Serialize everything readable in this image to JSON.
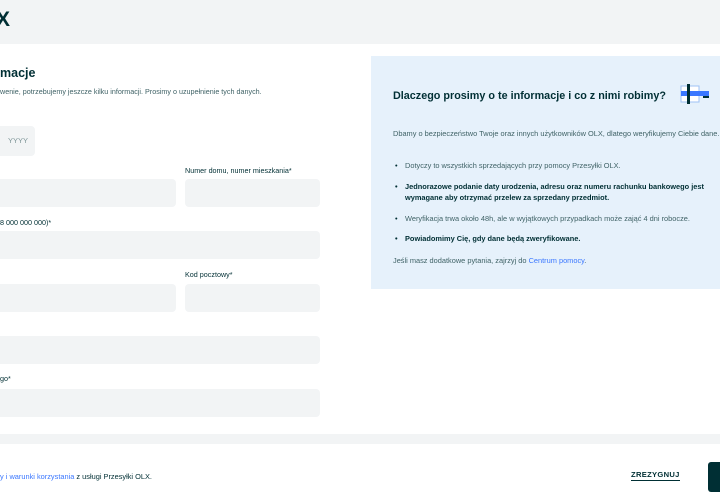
{
  "header": {
    "logo": "X"
  },
  "form": {
    "title": "macje",
    "subtitle": "wenie, potrzebujemy jeszcze kilku informacji. Prosimy o uzupełnienie tych danych.",
    "birth_year_placeholder": "YYYY",
    "labels": {
      "house_number": "Numer domu, numer mieszkania*",
      "account_number": "8 000 000 000)*",
      "postal_code": "Kod pocztowy*",
      "last_field": "go*"
    }
  },
  "info": {
    "title": "Dlaczego prosimy o te informacje i co z nimi robimy?",
    "intro": "Dbamy o bezpieczeństwo Twoje oraz innych użytkowników OLX, dlatego weryfikujemy Ciebie dane.",
    "bullets": [
      "Dotyczy to wszystkich sprzedających przy pomocy Przesyłki OLX.",
      "Jednorazowe podanie daty urodzenia, adresu oraz numeru rachunku bankowego jest wymagane aby otrzymać przelew za sprzedany przedmiot.",
      "Weryfikacja trwa około 48h, ale w wyjątkowych przypadkach może zająć 4 dni robocze.",
      "Powiadomimy Cię, gdy dane będą zweryfikowane."
    ],
    "help_prefix": "Jeśli masz dodatkowe pytania, zajrzyj do ",
    "help_link": "Centrum pomocy",
    "help_suffix": "."
  },
  "footer": {
    "terms_link": "y i warunki korzystania",
    "terms_suffix": " z usługi Przesyłki OLX.",
    "resign_label": "ZREZYGNUJ"
  },
  "colors": {
    "primary": "#002f34",
    "info_bg": "#e6f1fb",
    "link": "#3a77ff",
    "input_bg": "#f2f4f5"
  },
  "icons": {
    "info_illustration": "parcel-illustration-icon"
  }
}
